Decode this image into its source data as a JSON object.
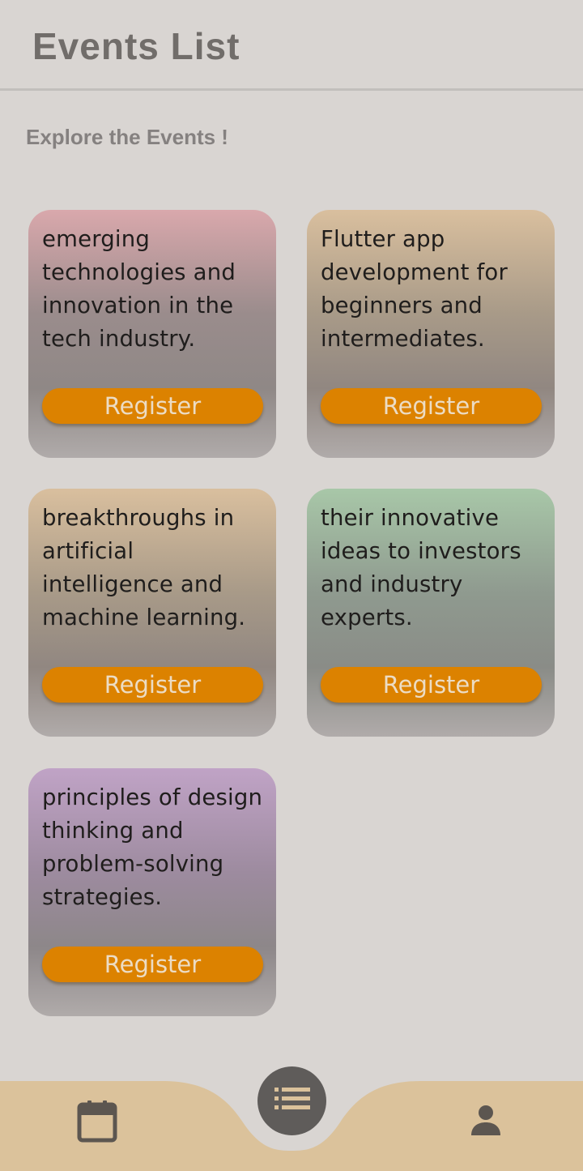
{
  "app_bar": {
    "title": "Events List"
  },
  "subtitle": "Explore the Events !",
  "events": [
    {
      "description": "emerging technologies and innovation in the tech industry.",
      "button_label": "Register",
      "theme": "pink"
    },
    {
      "description": "Flutter app development for beginners and intermediates.",
      "button_label": "Register",
      "theme": "tan"
    },
    {
      "description": "breakthroughs in artificial intelligence and machine learning.",
      "button_label": "Register",
      "theme": "tan"
    },
    {
      "description": "their innovative ideas to investors and industry experts.",
      "button_label": "Register",
      "theme": "green"
    },
    {
      "description": "principles of design thinking and problem-solving strategies.",
      "button_label": "Register",
      "theme": "purple"
    }
  ],
  "bottom_nav": {
    "items": [
      {
        "icon": "calendar-icon",
        "active": false
      },
      {
        "icon": "list-icon",
        "active": true
      },
      {
        "icon": "person-icon",
        "active": false
      }
    ],
    "background_color": "#dbc29b",
    "fab_color": "#5f5c5a"
  },
  "colors": {
    "background": "#d9d5d2",
    "button": "#dc8200",
    "button_text": "#ecdcc4",
    "title_text": "#716d6a"
  }
}
